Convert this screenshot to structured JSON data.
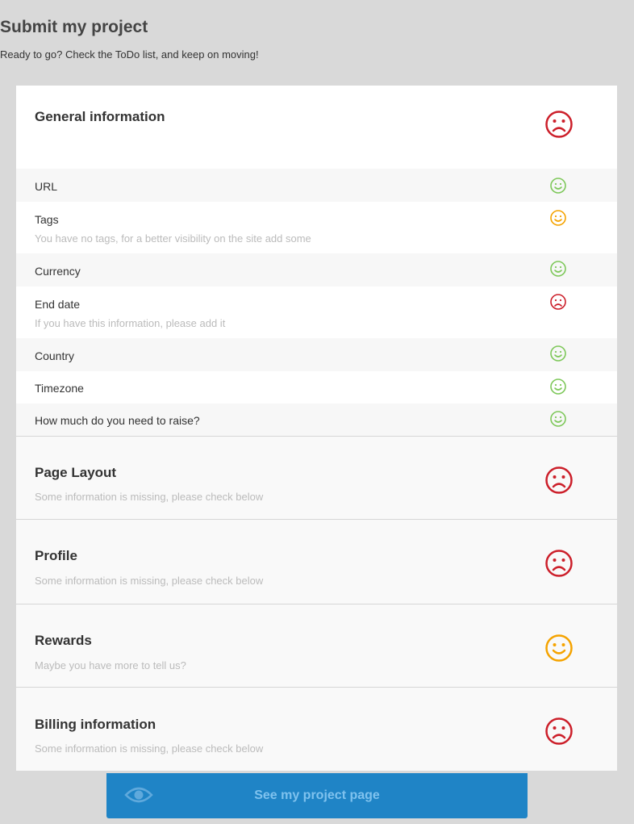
{
  "header": {
    "title": "Submit my project",
    "subtitle": "Ready to go? Check the ToDo list, and keep on moving!"
  },
  "general": {
    "title": "General information",
    "status": "sad-red",
    "items": [
      {
        "label": "URL",
        "note": "",
        "status": "happy-green"
      },
      {
        "label": "Tags",
        "note": "You have no tags, for a better visibility on the site add some",
        "status": "happy-orange"
      },
      {
        "label": "Currency",
        "note": "",
        "status": "happy-green"
      },
      {
        "label": "End date",
        "note": "If you have this information, please add it",
        "status": "sad-red"
      },
      {
        "label": "Country",
        "note": "",
        "status": "happy-green"
      },
      {
        "label": "Timezone",
        "note": "",
        "status": "happy-green"
      },
      {
        "label": "How much do you need to raise?",
        "note": "",
        "status": "happy-green"
      }
    ]
  },
  "sections": [
    {
      "title": "Page Layout",
      "note": "Some information is missing, please check below",
      "status": "sad-red"
    },
    {
      "title": "Profile",
      "note": "Some information is missing, please check below",
      "status": "sad-red"
    },
    {
      "title": "Rewards",
      "note": "Maybe you have more to tell us?",
      "status": "happy-orange"
    },
    {
      "title": "Billing information",
      "note": "Some information is missing, please check below",
      "status": "sad-red"
    }
  ],
  "cta": {
    "label": "See my project page",
    "icon": "eye-icon"
  },
  "colors": {
    "red": "#cc1f2a",
    "orange": "#f5a300",
    "green": "#7ec85a",
    "button": "#1f84c6"
  }
}
